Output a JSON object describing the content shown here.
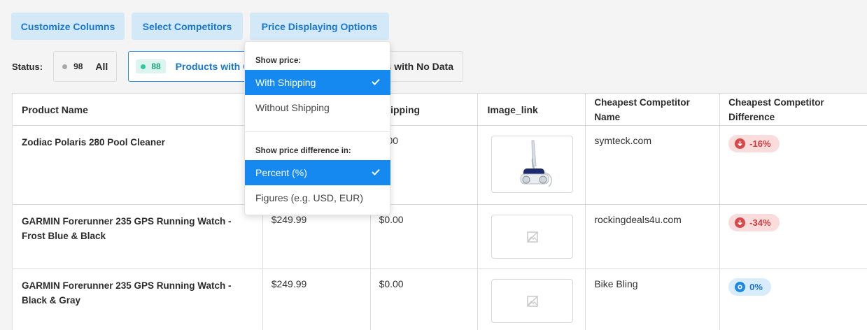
{
  "toolbar": {
    "customize_columns": "Customize Columns",
    "select_competitors": "Select Competitors",
    "price_displaying_options": "Price Displaying Options"
  },
  "status": {
    "label": "Status:",
    "filters": [
      {
        "count": "98",
        "label": "All"
      },
      {
        "count": "88",
        "label": "Products with Co"
      },
      {
        "label": "s with No Data"
      }
    ]
  },
  "price_options": {
    "show_price_heading": "Show price:",
    "with_shipping": "With Shipping",
    "without_shipping": "Without Shipping",
    "show_diff_heading": "Show price difference in:",
    "percent": "Percent (%)",
    "figures": "Figures (e.g. USD, EUR)"
  },
  "table": {
    "headers": [
      "Product Name",
      "",
      "hipping",
      "Image_link",
      "Cheapest Competitor Name",
      "Cheapest Competitor Difference"
    ],
    "rows": [
      {
        "name": "Zodiac Polaris 280 Pool Cleaner",
        "price": "",
        "shipping": ".00",
        "competitor": "symteck.com",
        "difference": "-16%",
        "trend": "down"
      },
      {
        "name": "GARMIN Forerunner 235 GPS Running Watch - Frost Blue & Black",
        "price": "$249.99",
        "shipping": "$0.00",
        "competitor": "rockingdeals4u.com",
        "difference": "-34%",
        "trend": "down"
      },
      {
        "name": "GARMIN Forerunner 235 GPS Running Watch - Black & Gray",
        "price": "$249.99",
        "shipping": "$0.00",
        "competitor": "Bike Bling",
        "difference": "0%",
        "trend": "neutral"
      }
    ]
  },
  "colors": {
    "accent": "#1589f0",
    "button_bg": "#d4e9f8",
    "negative": "#d94848",
    "positive_badge": "#2dc9a0"
  }
}
